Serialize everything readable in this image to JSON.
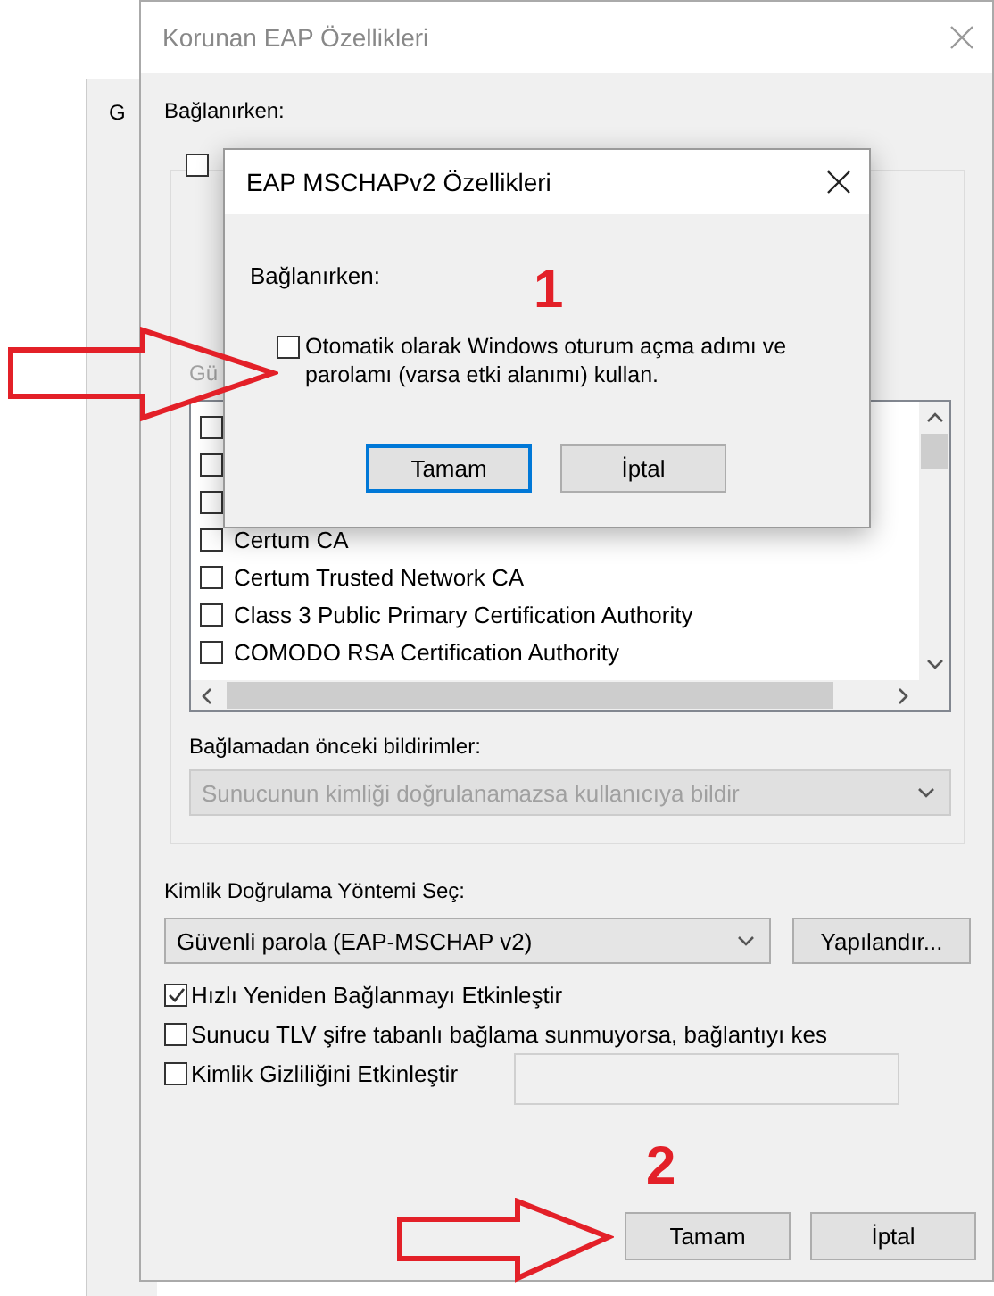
{
  "background_window": {
    "label": "G"
  },
  "dialog": {
    "title": "Korunan EAP Özellikleri",
    "connecting_label": "Bağlanırken:",
    "top_checkbox": {
      "checked": false
    },
    "trusted_label_fragment": "Gü",
    "certificates": [
      {
        "checked": false
      },
      {
        "checked": false
      },
      {
        "checked": false
      },
      {
        "label": "Certum CA",
        "checked": false
      },
      {
        "label": "Certum Trusted Network CA",
        "checked": false
      },
      {
        "label": "Class 3 Public Primary Certification Authority",
        "checked": false
      },
      {
        "label": "COMODO RSA Certification Authority",
        "checked": false
      }
    ],
    "notifications_label": "Bağlamadan önceki bildirimler:",
    "notifications_select": {
      "value": "Sunucunun kimliği doğrulanamazsa kullanıcıya bildir",
      "disabled": true
    },
    "auth_method_label": "Kimlik Doğrulama Yöntemi Seç:",
    "auth_method_select": {
      "value": "Güvenli parola (EAP-MSCHAP v2)",
      "disabled": false
    },
    "configure_button": "Yapılandır...",
    "options": [
      {
        "kind": "checkbox",
        "label": "Hızlı Yeniden Bağlanmayı Etkinleştir",
        "checked": true
      },
      {
        "kind": "checkbox",
        "label": "Sunucu TLV şifre tabanlı bağlama sunmuyorsa, bağlantıyı kes",
        "checked": false
      },
      {
        "kind": "checkbox-field",
        "label": "Kimlik Gizliliğini Etkinleştir",
        "checked": false
      }
    ],
    "buttons": [
      {
        "label": "Tamam",
        "default": false
      },
      {
        "label": "İptal",
        "default": false
      }
    ]
  },
  "inner_dialog": {
    "title": "EAP MSCHAPv2 Özellikleri",
    "connecting_label": "Bağlanırken:",
    "auto_logon": {
      "label": "Otomatik olarak Windows oturum açma adımı ve parolamı (varsa etki alanımı) kullan.",
      "checked": false
    },
    "buttons": [
      {
        "label": "Tamam",
        "default": true
      },
      {
        "label": "İptal",
        "default": false
      }
    ]
  },
  "annotations": [
    {
      "label": "1"
    },
    {
      "label": "2"
    }
  ]
}
